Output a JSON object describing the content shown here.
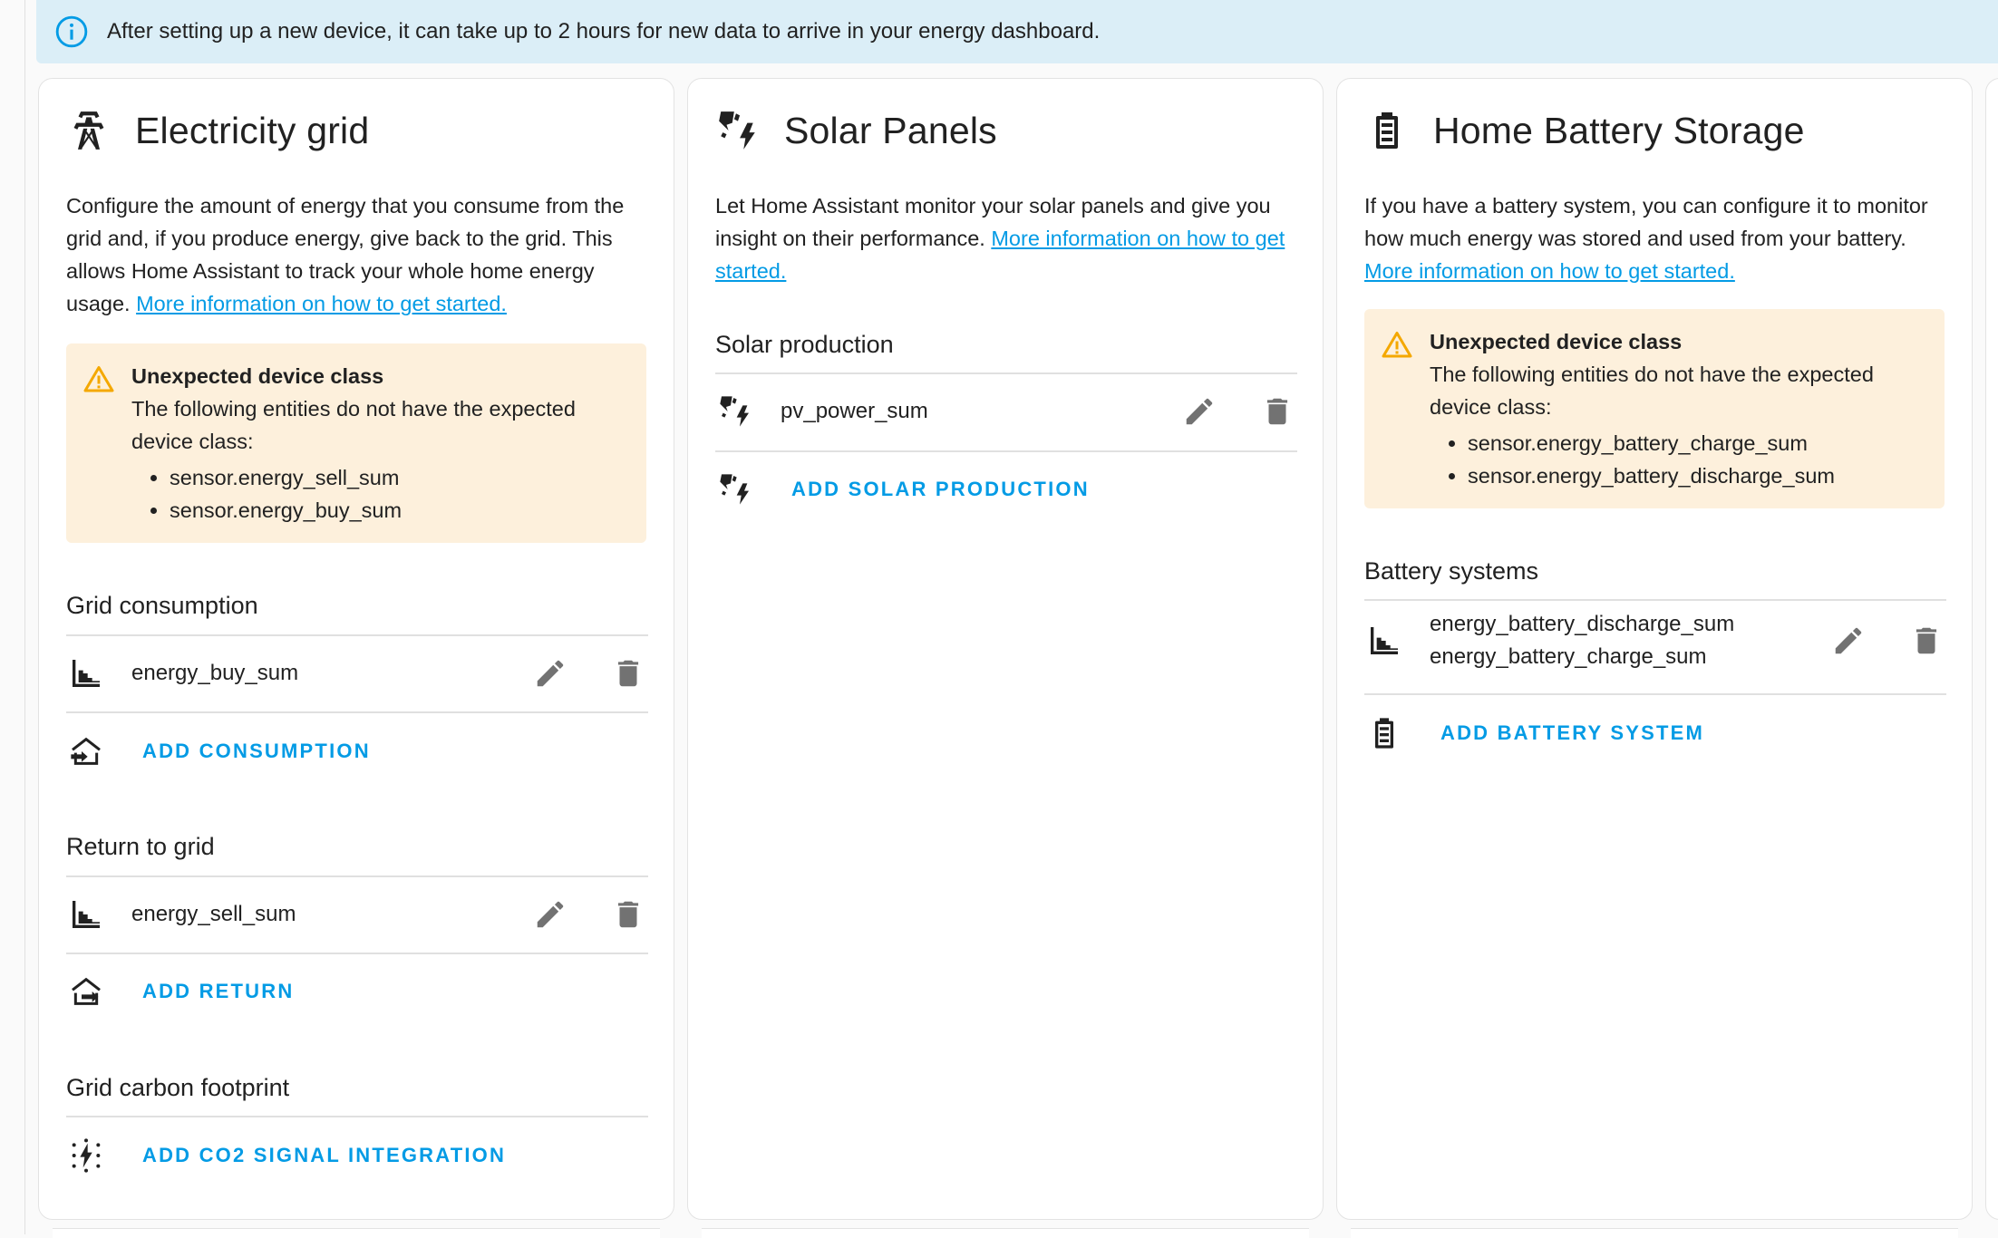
{
  "info_banner": {
    "text": "After setting up a new device, it can take up to 2 hours for new data to arrive in your energy dashboard."
  },
  "grid": {
    "title": "Electricity grid",
    "description": "Configure the amount of energy that you consume from the grid and, if you produce energy, give back to the grid. This allows Home Assistant to track your whole home energy usage.",
    "link": "More information on how to get started.",
    "warning": {
      "title": "Unexpected device class",
      "text": "The following entities do not have the expected device class:",
      "items": [
        "sensor.energy_sell_sum",
        "sensor.energy_buy_sum"
      ]
    },
    "consumption": {
      "title": "Grid consumption",
      "entity": "energy_buy_sum",
      "add_label": "ADD CONSUMPTION"
    },
    "return": {
      "title": "Return to grid",
      "entity": "energy_sell_sum",
      "add_label": "ADD RETURN"
    },
    "carbon": {
      "title": "Grid carbon footprint",
      "add_label": "ADD CO2 SIGNAL INTEGRATION"
    }
  },
  "solar": {
    "title": "Solar Panels",
    "description": "Let Home Assistant monitor your solar panels and give you insight on their performance.",
    "link": "More information on how to get started.",
    "production": {
      "title": "Solar production",
      "entity": "pv_power_sum",
      "add_label": "ADD SOLAR PRODUCTION"
    }
  },
  "battery": {
    "title": "Home Battery Storage",
    "description": "If you have a battery system, you can configure it to monitor how much energy was stored and used from your battery.",
    "link": "More information on how to get started.",
    "warning": {
      "title": "Unexpected device class",
      "text": "The following entities do not have the expected device class:",
      "items": [
        "sensor.energy_battery_charge_sum",
        "sensor.energy_battery_discharge_sum"
      ]
    },
    "systems": {
      "title": "Battery systems",
      "entity_line1": "energy_battery_discharge_sum",
      "entity_line2": "energy_battery_charge_sum",
      "add_label": "ADD BATTERY SYSTEM"
    }
  },
  "colors": {
    "accent": "#039be5",
    "warning_bg": "#fdf0dc",
    "warning_icon": "#f4a800",
    "info_bg": "#dbeef7",
    "icon_gray": "#727272"
  },
  "icons": {
    "info": "info-circle-icon",
    "grid": "transmission-tower-icon",
    "solar": "solar-power-icon",
    "battery": "battery-icon",
    "warning": "alert-triangle-icon",
    "stats": "chart-step-icon",
    "edit": "pencil-icon",
    "delete": "trash-icon",
    "consumption": "home-import-icon",
    "return": "home-export-icon",
    "co2": "molecule-co2-icon"
  }
}
